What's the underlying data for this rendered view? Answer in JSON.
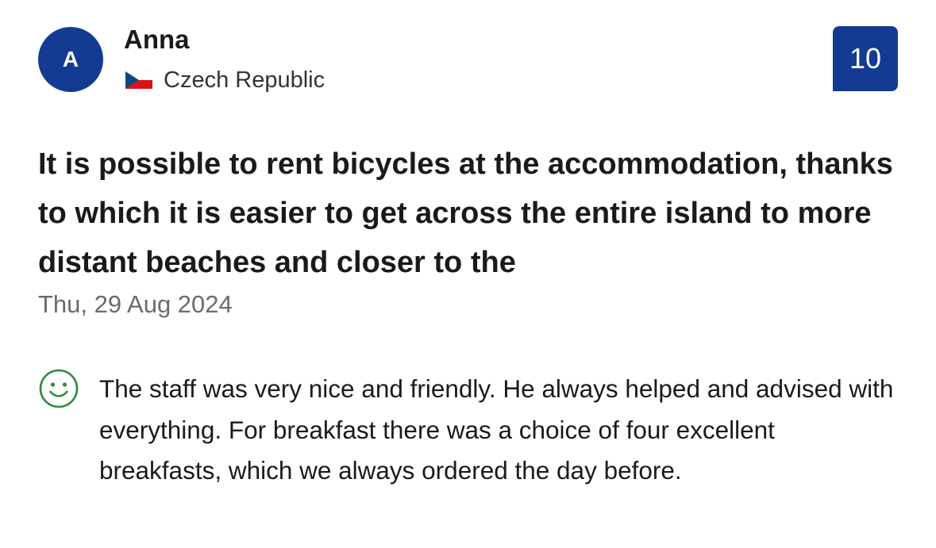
{
  "reviewer": {
    "initial": "A",
    "name": "Anna",
    "country": "Czech Republic",
    "flag_icon": "czech-flag-icon"
  },
  "score": "10",
  "review": {
    "title": "It is possible to rent bicycles at the accommodation, thanks to which it is easier to get across the entire island to more distant beaches and closer to the",
    "date": "Thu, 29 Aug 2024",
    "positive_icon": "smiley-face-icon",
    "positive_text": "The staff was very nice and friendly. He always helped and advised with everything. For breakfast there was a choice of four excellent breakfasts, which we always ordered the day before."
  },
  "colors": {
    "brand_blue": "#143b93",
    "positive_green": "#2e8b3c",
    "muted_text": "#6b6b6b"
  }
}
